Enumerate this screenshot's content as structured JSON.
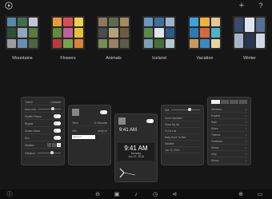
{
  "topbar": {
    "play_icon": "play-circle-icon",
    "add_label": "+",
    "help_label": "?"
  },
  "albums": [
    {
      "name": "Mountains",
      "colors": [
        "#5a86a8",
        "#3e6e4a",
        "#c0c8d8",
        "#2d4f36",
        "#8fa6bf",
        "#5c7a3a",
        "#9c9c9c",
        "#6b8db0",
        "#4a6640"
      ]
    },
    {
      "name": "Flowers",
      "colors": [
        "#e79a3a",
        "#d94f4f",
        "#f0d048",
        "#5f8e36",
        "#c25e9a",
        "#e5c03c",
        "#b93a3a",
        "#78a24a",
        "#d8842e"
      ]
    },
    {
      "name": "Animals",
      "colors": [
        "#8a7a5e",
        "#5e6b4d",
        "#a58a60",
        "#4c4c4c",
        "#b3a37a",
        "#6e5a42",
        "#7a8a5a",
        "#9a8160",
        "#5c5c48"
      ]
    },
    {
      "name": "Iceland",
      "colors": [
        "#6a96c2",
        "#3c6e9e",
        "#9ab6cc",
        "#5b8a46",
        "#e0e4ea",
        "#2f5a86",
        "#7aa0b8",
        "#486e36",
        "#b4c8d6"
      ]
    },
    {
      "name": "Vacation",
      "colors": [
        "#3aa4d8",
        "#f0b040",
        "#e2c896",
        "#2c7ab8",
        "#d46a3a",
        "#4cb4c8",
        "#c89a5a",
        "#3a8ac0",
        "#e8d4a2"
      ]
    },
    {
      "name": "Winter",
      "colors": [
        "#3a4a6a",
        "#dde4ee",
        "#5a6e8e",
        "#a8b4c8",
        "#2a3650",
        "#cfd8e4"
      ]
    }
  ],
  "panel_settings": {
    "tab_left": "Theme",
    "tab_right": "Calibrate",
    "rows": [
      {
        "label": "Auto Lock",
        "control": "slider"
      },
      {
        "label": "Shuffle Photos",
        "control": "toggle"
      },
      {
        "label": "Repeat",
        "control": "toggle"
      },
      {
        "label": "Screen Saver",
        "control": "toggle"
      },
      {
        "label": "Dim",
        "control": "toggle"
      },
      {
        "label": "Weather",
        "control": "segment"
      },
      {
        "label": "Vibration",
        "control": "slider"
      }
    ],
    "segment_value": "1"
  },
  "panel_photo": {
    "toggle_label": "",
    "row1_label": "Timer",
    "row1_value": "10 Seconds",
    "row2_label": "URL",
    "row2_value": "verify url",
    "input_placeholder": "www.url"
  },
  "panel_clock_small": {
    "time": "9:41 AM"
  },
  "panel_clock_large": {
    "time": "9:41 AM",
    "day": "Monday",
    "date": "Jun 12, 2016"
  },
  "panel_list": {
    "header": "Wifi",
    "items": [
      "Home Sprinkler",
      "Show My list",
      "To Do List",
      "Baby Rock To Bed",
      "Michelle",
      "Jun 12, 2016"
    ]
  },
  "panel_menu": {
    "items": [
      "Gestures",
      "Expand",
      "Rate",
      "Share",
      "Themes",
      "Feedback",
      "Shows",
      "Help",
      "Shows"
    ]
  },
  "bottombar": {
    "icons": [
      "info-icon",
      "back-icon",
      "photos-icon",
      "music-icon",
      "timer-icon",
      "rewind-icon",
      "forward-icon",
      "window-icon"
    ]
  }
}
